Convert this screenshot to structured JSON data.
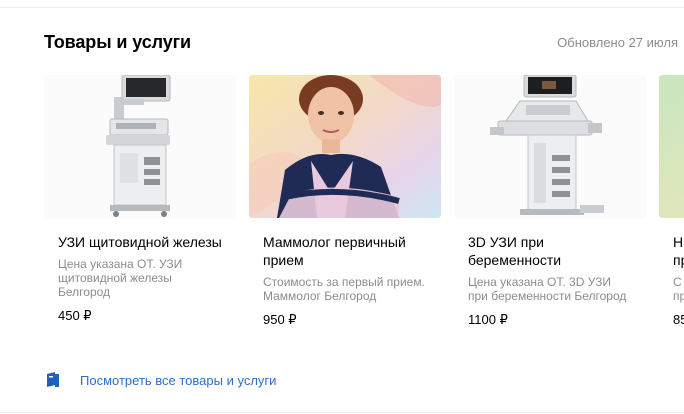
{
  "header": {
    "title": "Товары и услуги",
    "updated": "Обновлено 27 июля"
  },
  "cards": [
    {
      "title": "УЗИ щитовидной железы",
      "description": "Цена указана ОТ. УЗИ щитовидной железы Белгород",
      "price": "450 ₽",
      "image": "ultrasound-machine"
    },
    {
      "title": "Маммолог первичный прием",
      "description": "Стоимость за первый прием. Маммолог Белгород",
      "price": "950 ₽",
      "image": "doctor-photo"
    },
    {
      "title": "3D УЗИ при беременности",
      "description": "Цена указана ОТ. 3D УЗИ при беременности Белгород",
      "price": "1100 ₽",
      "image": "ultrasound-machine"
    },
    {
      "title": "Н",
      "description": "С",
      "price": "85",
      "title2": "пр",
      "desc2": "пр",
      "image": "partial"
    }
  ],
  "footer": {
    "link_label": "Посмотреть все товары и услуги",
    "icon": "book-icon"
  },
  "colors": {
    "link": "#2a6fcb",
    "muted": "#8c8c8c",
    "icon": "#1f5fbf"
  }
}
